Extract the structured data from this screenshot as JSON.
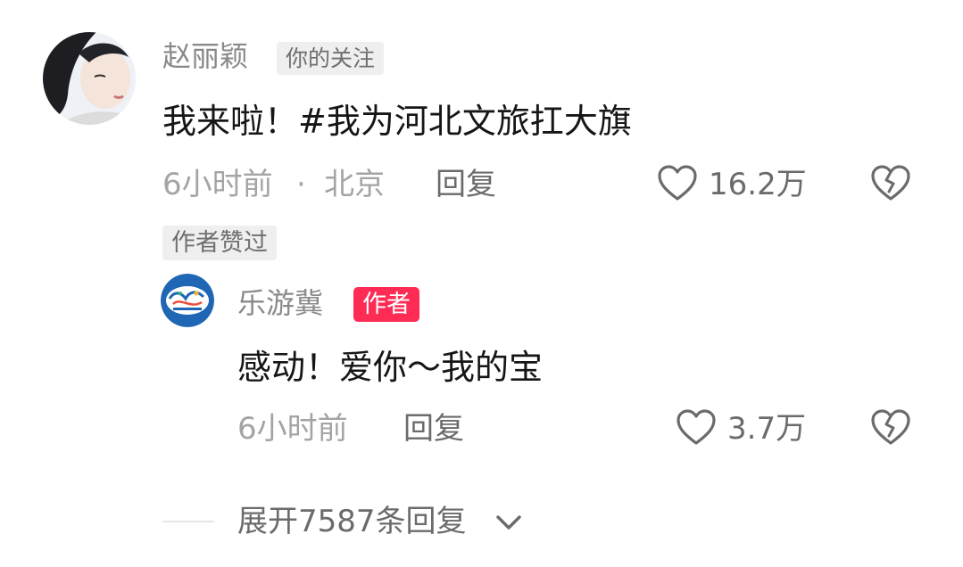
{
  "comment": {
    "author": "赵丽颖",
    "author_tag": "你的关注",
    "text": "我来啦！#我为河北文旅扛大旗",
    "time": "6小时前",
    "separator": "·",
    "location": "北京",
    "reply_label": "回复",
    "likes": "16.2万",
    "author_liked_badge": "作者赞过"
  },
  "reply": {
    "author": "乐游冀",
    "author_tag": "作者",
    "text": "感动！爱你～我的宝",
    "time": "6小时前",
    "reply_label": "回复",
    "likes": "3.7万"
  },
  "expand": {
    "label": "展开7587条回复"
  },
  "colors": {
    "accent_red": "#fe2c55",
    "meta_gray": "#a4a4a4",
    "icon_gray": "#6b6b6b"
  },
  "icons": {
    "like": "heart-outline-icon",
    "dislike": "broken-heart-icon",
    "expand": "chevron-down-icon"
  }
}
